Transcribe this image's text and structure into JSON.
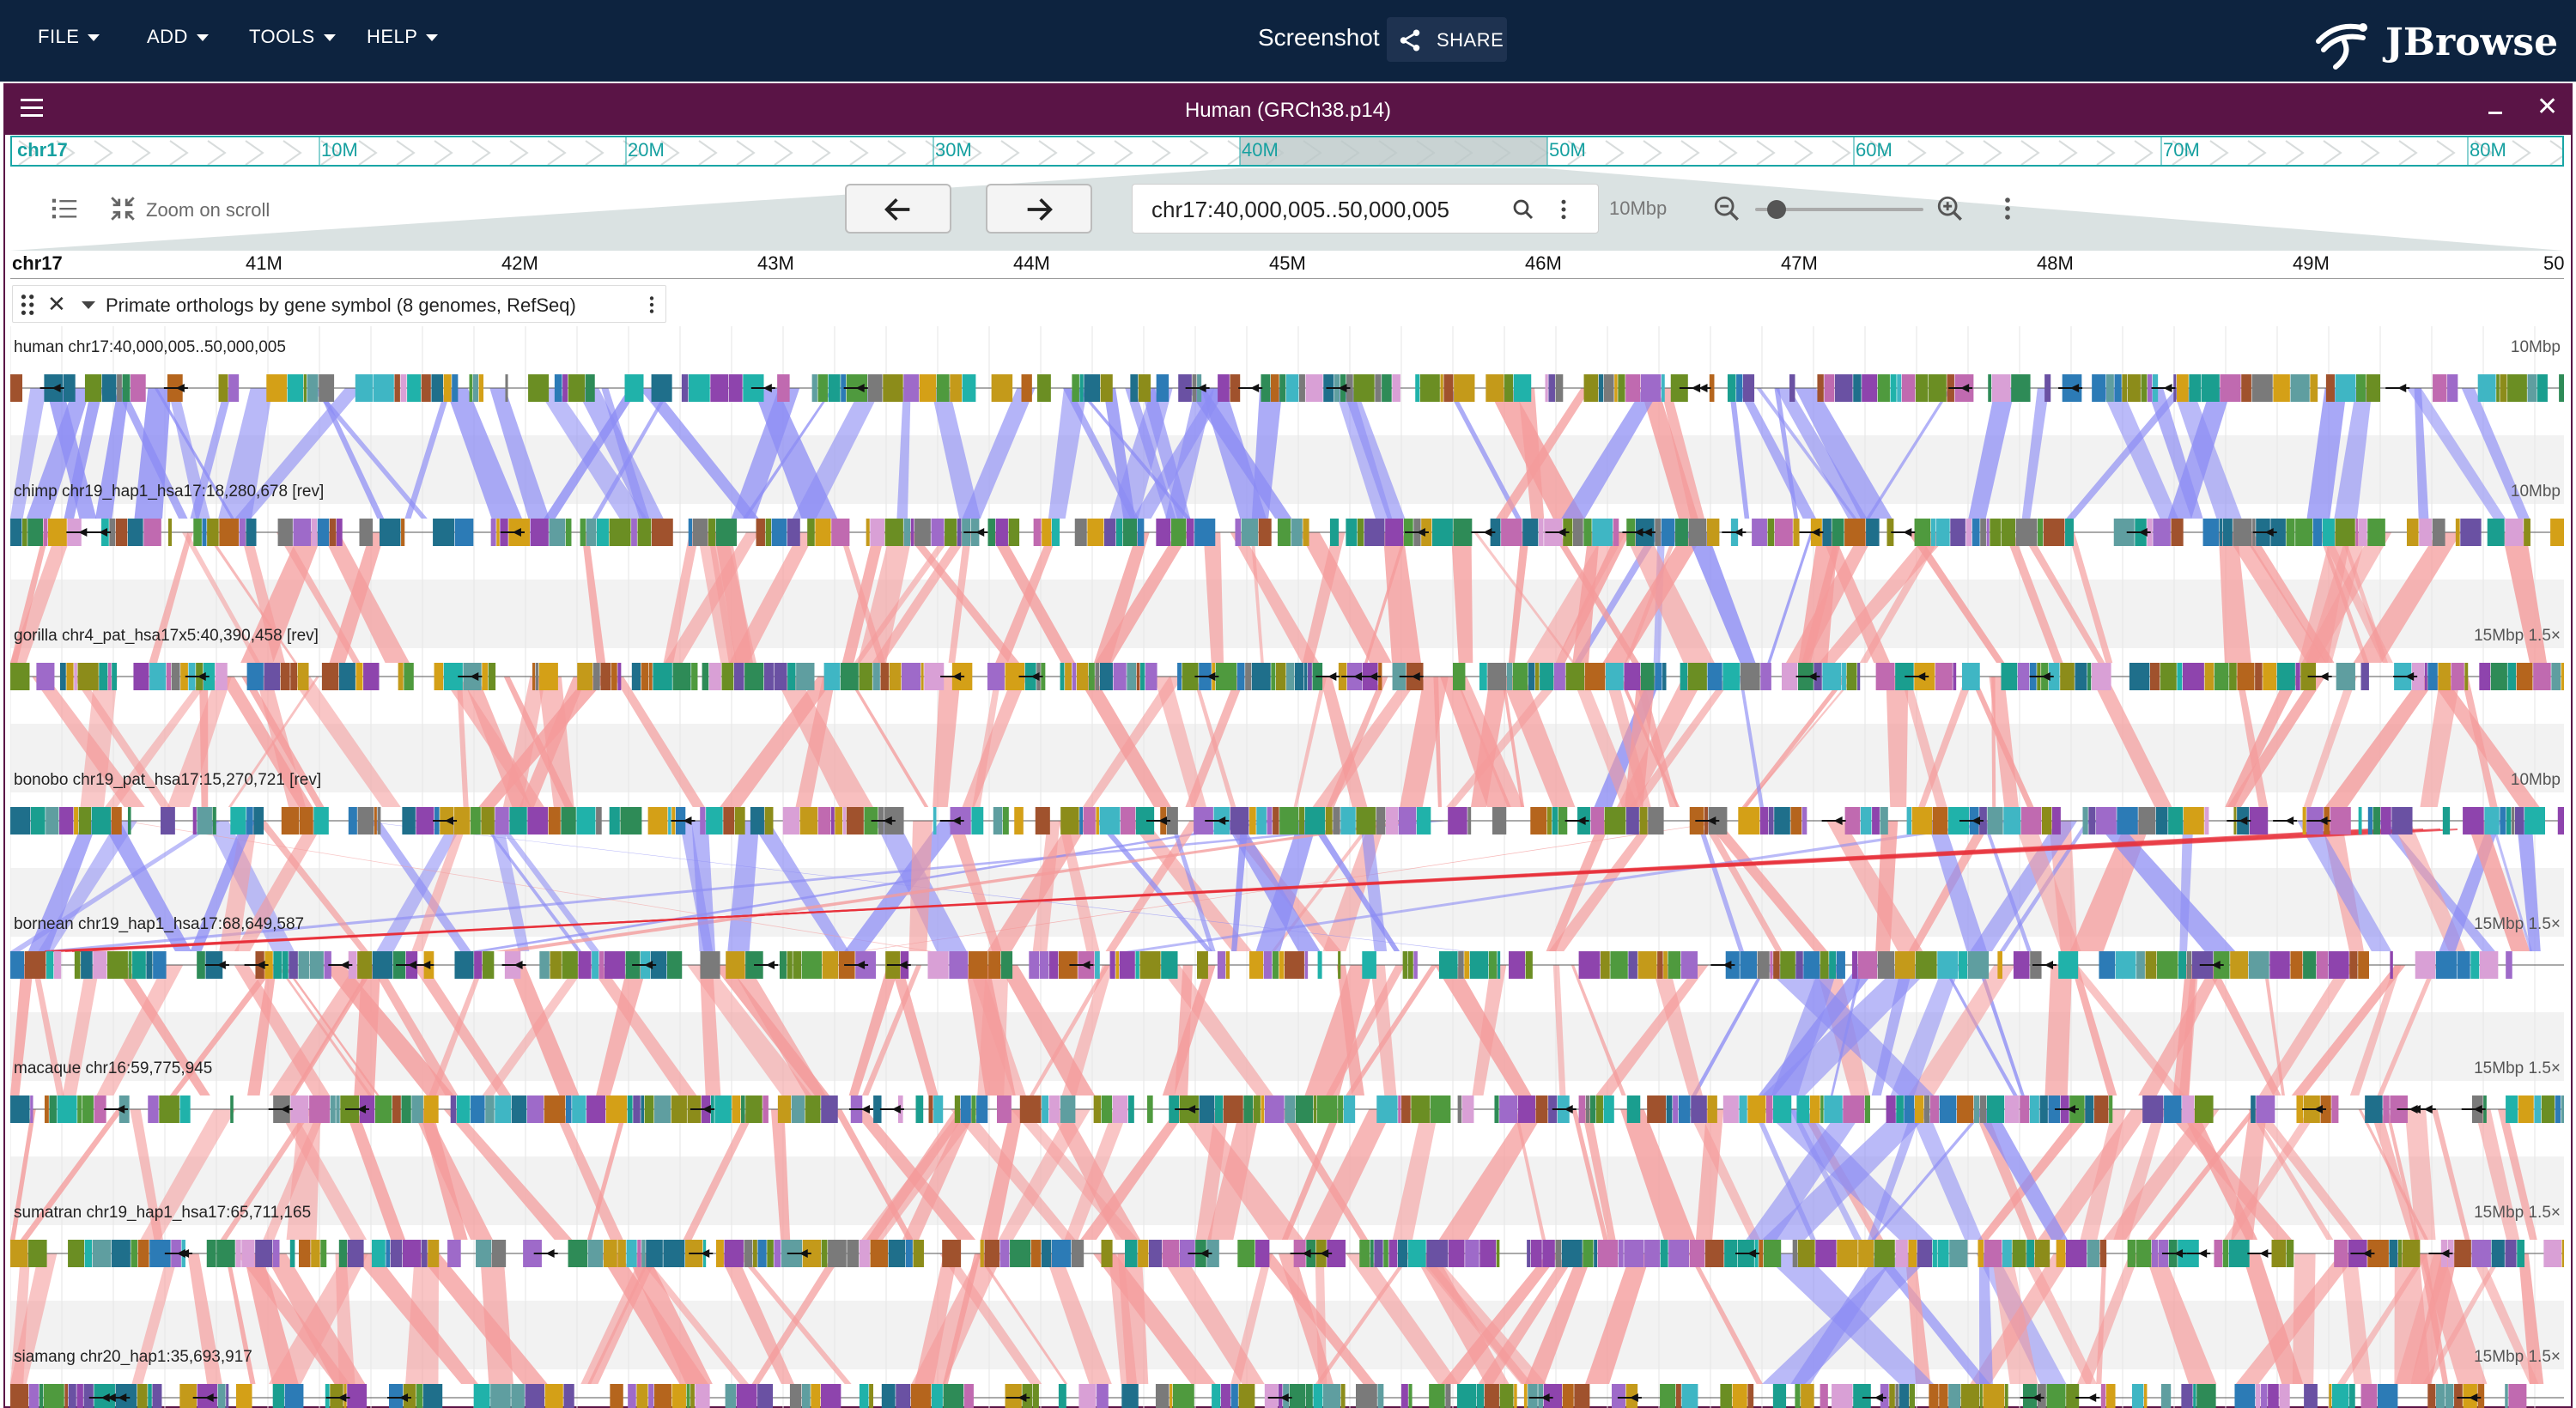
{
  "app": {
    "menus": [
      "FILE",
      "ADD",
      "TOOLS",
      "HELP"
    ],
    "session_name": "Screenshot",
    "share_label": "SHARE",
    "logo_text": "JBrowse",
    "colors": {
      "appbar": "#0d233f",
      "view_header": "#5a1446",
      "overview": "#1aa6a6",
      "forward_synteny": "#8c8cf4",
      "reverse_synteny": "#f49a9a"
    }
  },
  "view": {
    "title": "Human (GRCh38.p14)",
    "overview": {
      "chrom": "chr17",
      "labels": [
        "10M",
        "20M",
        "30M",
        "40M",
        "50M",
        "60M",
        "70M",
        "80M"
      ]
    },
    "toolbar": {
      "zoom_on_scroll": "Zoom on scroll",
      "location": "chr17:40,000,005..50,000,005",
      "bp_width": "10Mbp",
      "zoom_level": 0.12
    },
    "scale": {
      "chrom": "chr17",
      "ticks": [
        "41M",
        "42M",
        "43M",
        "44M",
        "45M",
        "46M",
        "47M",
        "48M",
        "49M",
        "50"
      ]
    },
    "track": {
      "name": "Primate orthologs by gene symbol (8 genomes, RefSeq)"
    },
    "genomes": [
      {
        "label": "human chr17:40,000,005..50,000,005",
        "right": "10Mbp"
      },
      {
        "label": "chimp chr19_hap1_hsa17:18,280,678 [rev]",
        "right": "10Mbp"
      },
      {
        "label": "gorilla chr4_pat_hsa17x5:40,390,458 [rev]",
        "right": "15Mbp 1.5×"
      },
      {
        "label": "bonobo chr19_pat_hsa17:15,270,721 [rev]",
        "right": "10Mbp"
      },
      {
        "label": "bornean chr19_hap1_hsa17:68,649,587",
        "right": "15Mbp 1.5×"
      },
      {
        "label": "macaque chr16:59,775,945",
        "right": "15Mbp 1.5×"
      },
      {
        "label": "sumatran chr19_hap1_hsa17:65,711,165",
        "right": "15Mbp 1.5×"
      },
      {
        "label": "siamang chr20_hap1:35,693,917",
        "right": "15Mbp 1.5×"
      }
    ]
  }
}
